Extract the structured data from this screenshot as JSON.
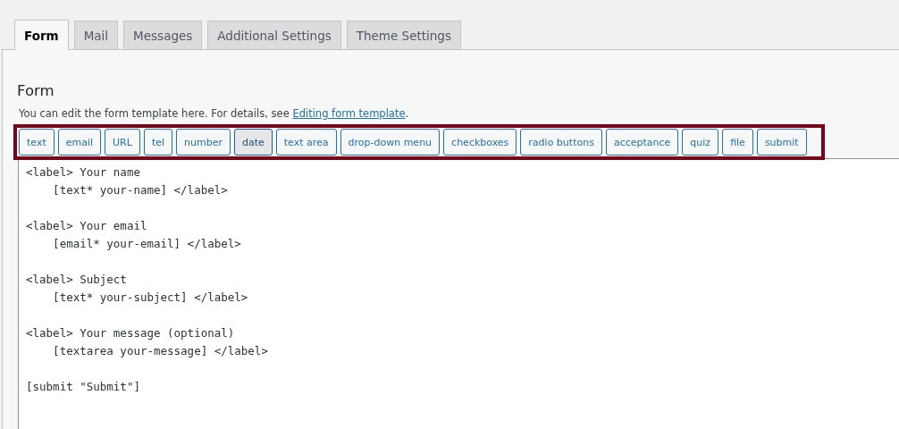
{
  "tabs": [
    {
      "label": "Form",
      "selected": true
    },
    {
      "label": "Mail",
      "selected": false
    },
    {
      "label": "Messages",
      "selected": false
    },
    {
      "label": "Additional Settings",
      "selected": false
    },
    {
      "label": "Theme Settings",
      "selected": false
    }
  ],
  "panel": {
    "heading": "Form",
    "description": "You can edit the form template here. For details, see ",
    "link": "Editing form template",
    "after_link": "."
  },
  "tag_buttons": [
    {
      "label": "text",
      "selected": false
    },
    {
      "label": "email",
      "selected": false
    },
    {
      "label": "URL",
      "selected": false
    },
    {
      "label": "tel",
      "selected": false
    },
    {
      "label": "number",
      "selected": false
    },
    {
      "label": "date",
      "selected": true
    },
    {
      "label": "text area",
      "selected": false
    },
    {
      "label": "drop-down menu",
      "selected": false
    },
    {
      "label": "checkboxes",
      "selected": false
    },
    {
      "label": "radio buttons",
      "selected": false
    },
    {
      "label": "acceptance",
      "selected": false
    },
    {
      "label": "quiz",
      "selected": false
    },
    {
      "label": "file",
      "selected": false
    },
    {
      "label": "submit",
      "selected": false
    }
  ],
  "editor": {
    "value": "<label> Your name\n    [text* your-name] </label>\n\n<label> Your email\n    [email* your-email] </label>\n\n<label> Subject\n    [text* your-subject] </label>\n\n<label> Your message (optional)\n    [textarea your-message] </label>\n\n[submit \"Submit\"]"
  }
}
